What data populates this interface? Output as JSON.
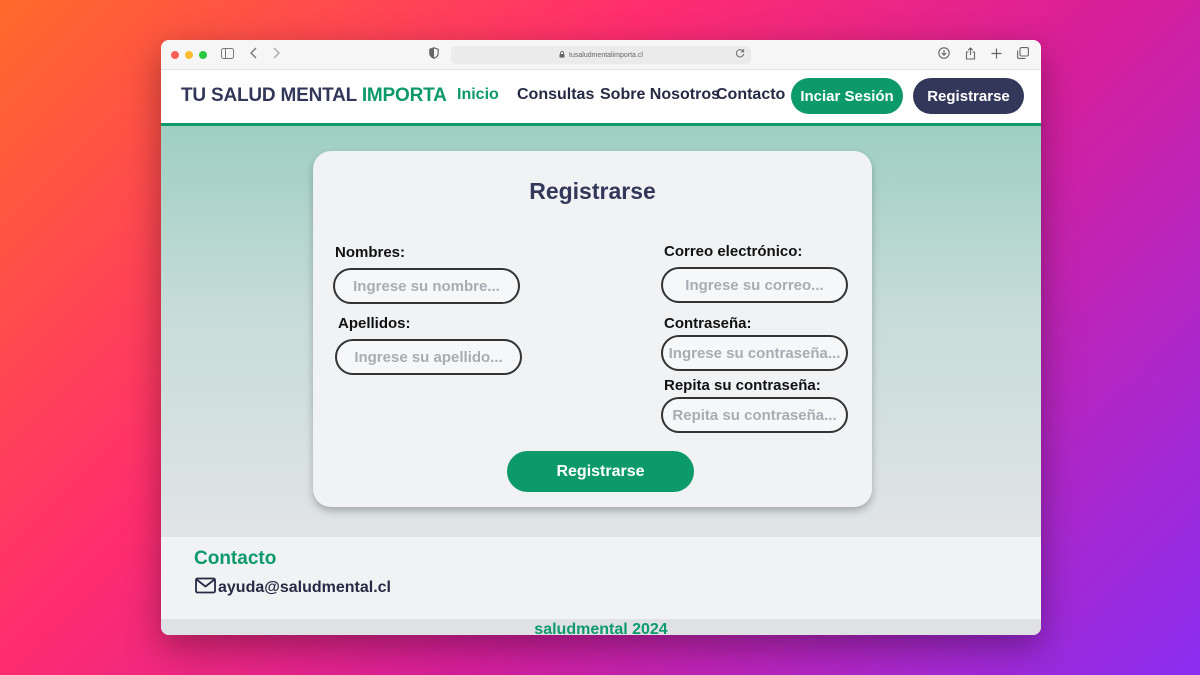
{
  "browser": {
    "url": "tusaludmentalimporta.cl"
  },
  "navbar": {
    "brand_main": "TU SALUD MENTAL ",
    "brand_accent": "IMPORTA",
    "links": [
      {
        "label": "Inicio",
        "active": true
      },
      {
        "label": "Consultas",
        "active": false
      },
      {
        "label": "Sobre Nosotros",
        "active": false
      },
      {
        "label": "Contacto",
        "active": false
      }
    ],
    "login_label": "Inciar Sesión",
    "register_label": "Registrarse"
  },
  "form": {
    "title": "Registrarse",
    "nombres_label": "Nombres:",
    "nombres_placeholder": "Ingrese su nombre...",
    "apellidos_label": "Apellidos:",
    "apellidos_placeholder": "Ingrese su apellido...",
    "correo_label": "Correo electrónico:",
    "correo_placeholder": "Ingrese su correo...",
    "password_label": "Contraseña:",
    "password_placeholder": "Ingrese su contraseña...",
    "repeat_label": "Repita su contraseña:",
    "repeat_placeholder": "Repita su contraseña...",
    "submit_label": "Registrarse"
  },
  "footer": {
    "title": "Contacto",
    "email": "ayuda@saludmental.cl",
    "copyright": "saludmental 2024"
  },
  "colors": {
    "accent_green": "#0c9a6a",
    "navy": "#33385a"
  }
}
